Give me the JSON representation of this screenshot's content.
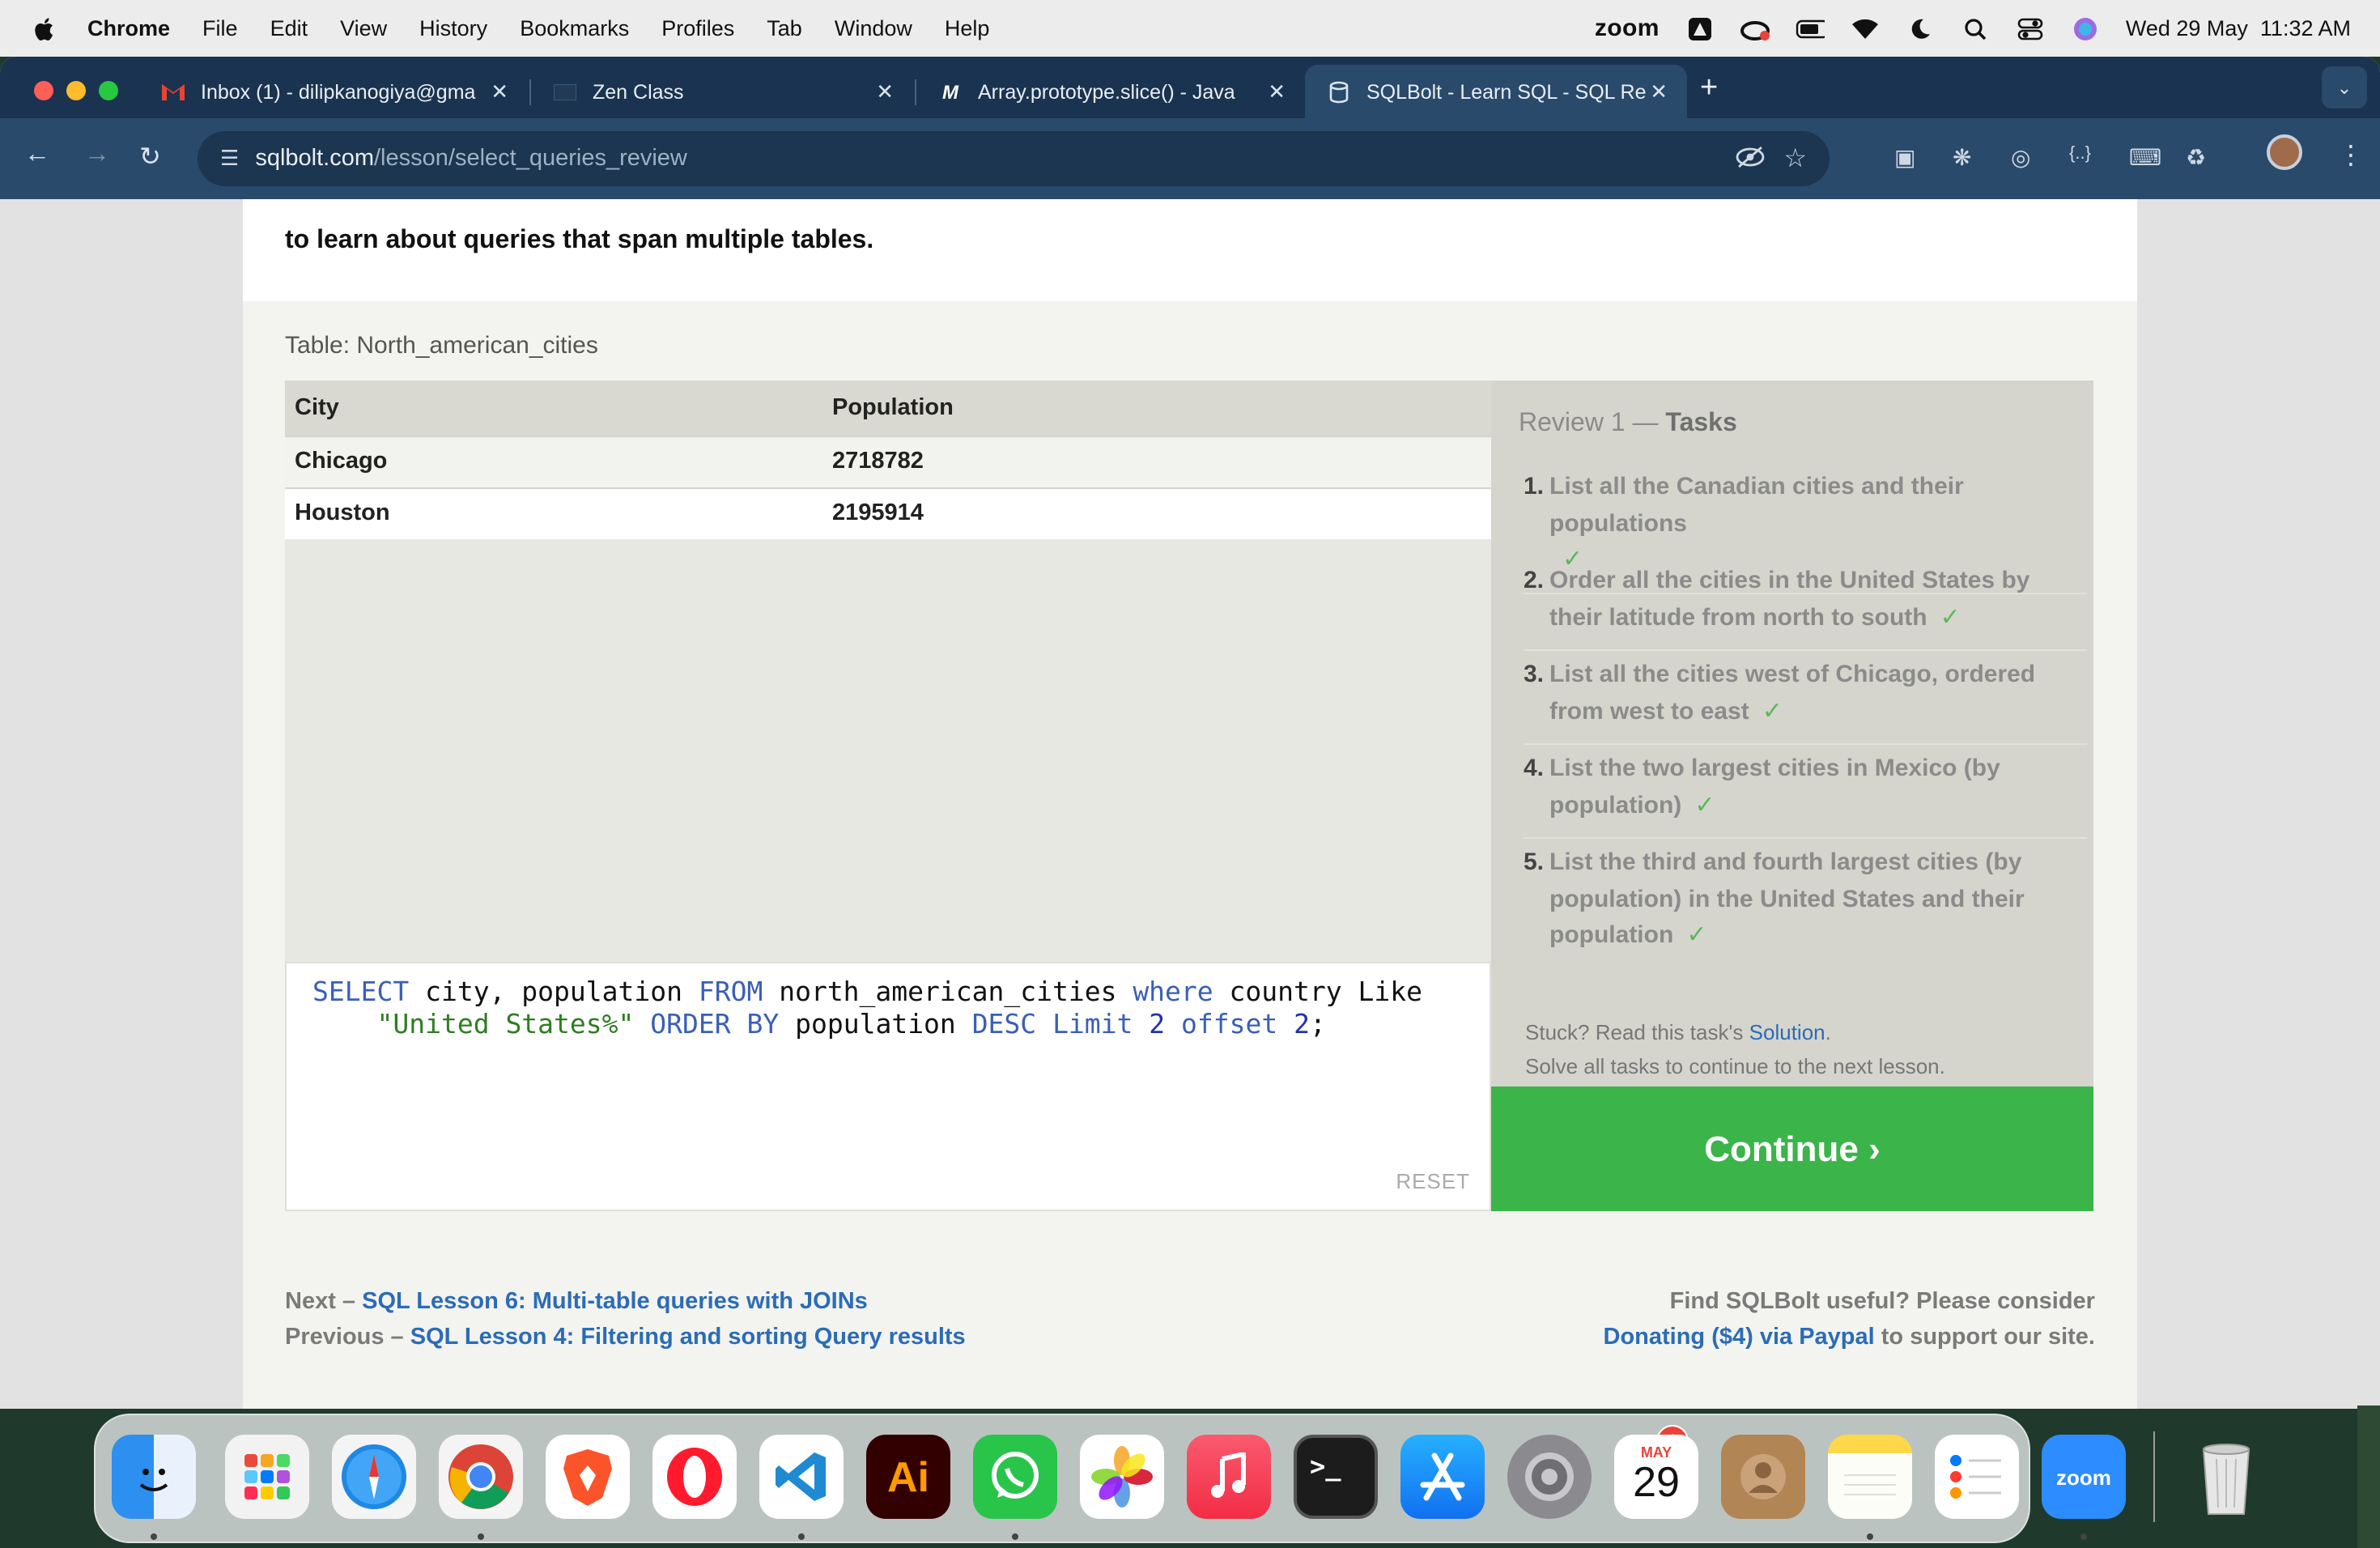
{
  "menubar": {
    "app": "Chrome",
    "items": [
      "File",
      "Edit",
      "View",
      "History",
      "Bookmarks",
      "Profiles",
      "Tab",
      "Window",
      "Help"
    ],
    "status_icons": [
      "zoom-icon",
      "adobe-icon",
      "creative-cloud-icon",
      "battery-icon",
      "wifi-icon",
      "focus-moon-icon",
      "spotlight-icon",
      "control-center-icon",
      "siri-icon"
    ],
    "zoom_label": "zoom",
    "datetime": "Wed 29 May  11:32 AM"
  },
  "tabs": [
    {
      "title": "Inbox (1) - dilipkanogiya@gma",
      "icon": "gmail-icon",
      "close": "✕"
    },
    {
      "title": "Zen Class",
      "icon": "zen-class-icon",
      "close": "✕"
    },
    {
      "title": "Array.prototype.slice() - Java",
      "icon": "mdn-icon",
      "close": "✕"
    },
    {
      "title": "SQLBolt - Learn SQL - SQL Re",
      "icon": "sqlbolt-icon",
      "close": "✕",
      "active": true
    }
  ],
  "address_bar": {
    "host": "sqlbolt.com",
    "path": "/lesson/select_queries_review"
  },
  "page": {
    "intro_line": "to learn about queries that span multiple tables.",
    "table_caption": "Table: North_american_cities",
    "columns": [
      "City",
      "Population"
    ],
    "rows": [
      [
        "Chicago",
        "2718782"
      ],
      [
        "Houston",
        "2195914"
      ]
    ],
    "query": {
      "line1": [
        "SELECT",
        " city, population ",
        "FROM",
        " north_american_cities ",
        "where",
        " country Like"
      ],
      "line2": [
        "\"United States%\"",
        " ",
        "ORDER BY",
        " population ",
        "DESC",
        " ",
        "Limit",
        " ",
        "2",
        " ",
        "offset",
        " ",
        "2",
        ";"
      ]
    },
    "reset_label": "RESET",
    "tasks_title_prefix": "Review 1 — ",
    "tasks_title_suffix": "Tasks",
    "tasks": [
      {
        "num": "1.",
        "text": "List all the Canadian cities and their populations",
        "done": "✓"
      },
      {
        "num": "2.",
        "text": "Order all the cities in the United States by their latitude from north to south",
        "done": "✓"
      },
      {
        "num": "3.",
        "text": "List all the cities west of Chicago, ordered from west to east",
        "done": "✓"
      },
      {
        "num": "4.",
        "text": "List the two largest cities in Mexico (by population)",
        "done": "✓"
      },
      {
        "num": "5.",
        "text": "List the third and fourth largest cities (by population) in the United States and their population",
        "done": "✓"
      }
    ],
    "stuck_prefix": "Stuck? Read this task's ",
    "stuck_link": "Solution",
    "stuck_suffix": ".",
    "solve_all": "Solve all tasks to continue to the next lesson.",
    "continue_label": "Continue ›",
    "next_prefix": "Next – ",
    "next_link": "SQL Lesson 6: Multi-table queries with JOINs",
    "prev_prefix": "Previous – ",
    "prev_link": "SQL Lesson 4: Filtering and sorting Query results",
    "support_line1": "Find SQLBolt useful? Please consider",
    "support_link": "Donating ($4) via Paypal",
    "support_suffix": " to support our site."
  },
  "dock": {
    "apps": [
      "finder-icon",
      "launchpad-icon",
      "safari-icon",
      "chrome-icon",
      "brave-icon",
      "opera-icon",
      "vscode-icon",
      "illustrator-icon",
      "whatsapp-icon",
      "photos-icon",
      "music-icon",
      "terminal-icon",
      "app-store-icon",
      "system-settings-icon",
      "calendar-icon",
      "contacts-icon",
      "notes-icon",
      "reminders-icon",
      "zoom-app-icon",
      "trash-icon"
    ],
    "settings_badge": "1",
    "calendar_month": "MAY",
    "calendar_day": "29",
    "illustrator_label": "Ai",
    "zoom_label": "zoom"
  }
}
